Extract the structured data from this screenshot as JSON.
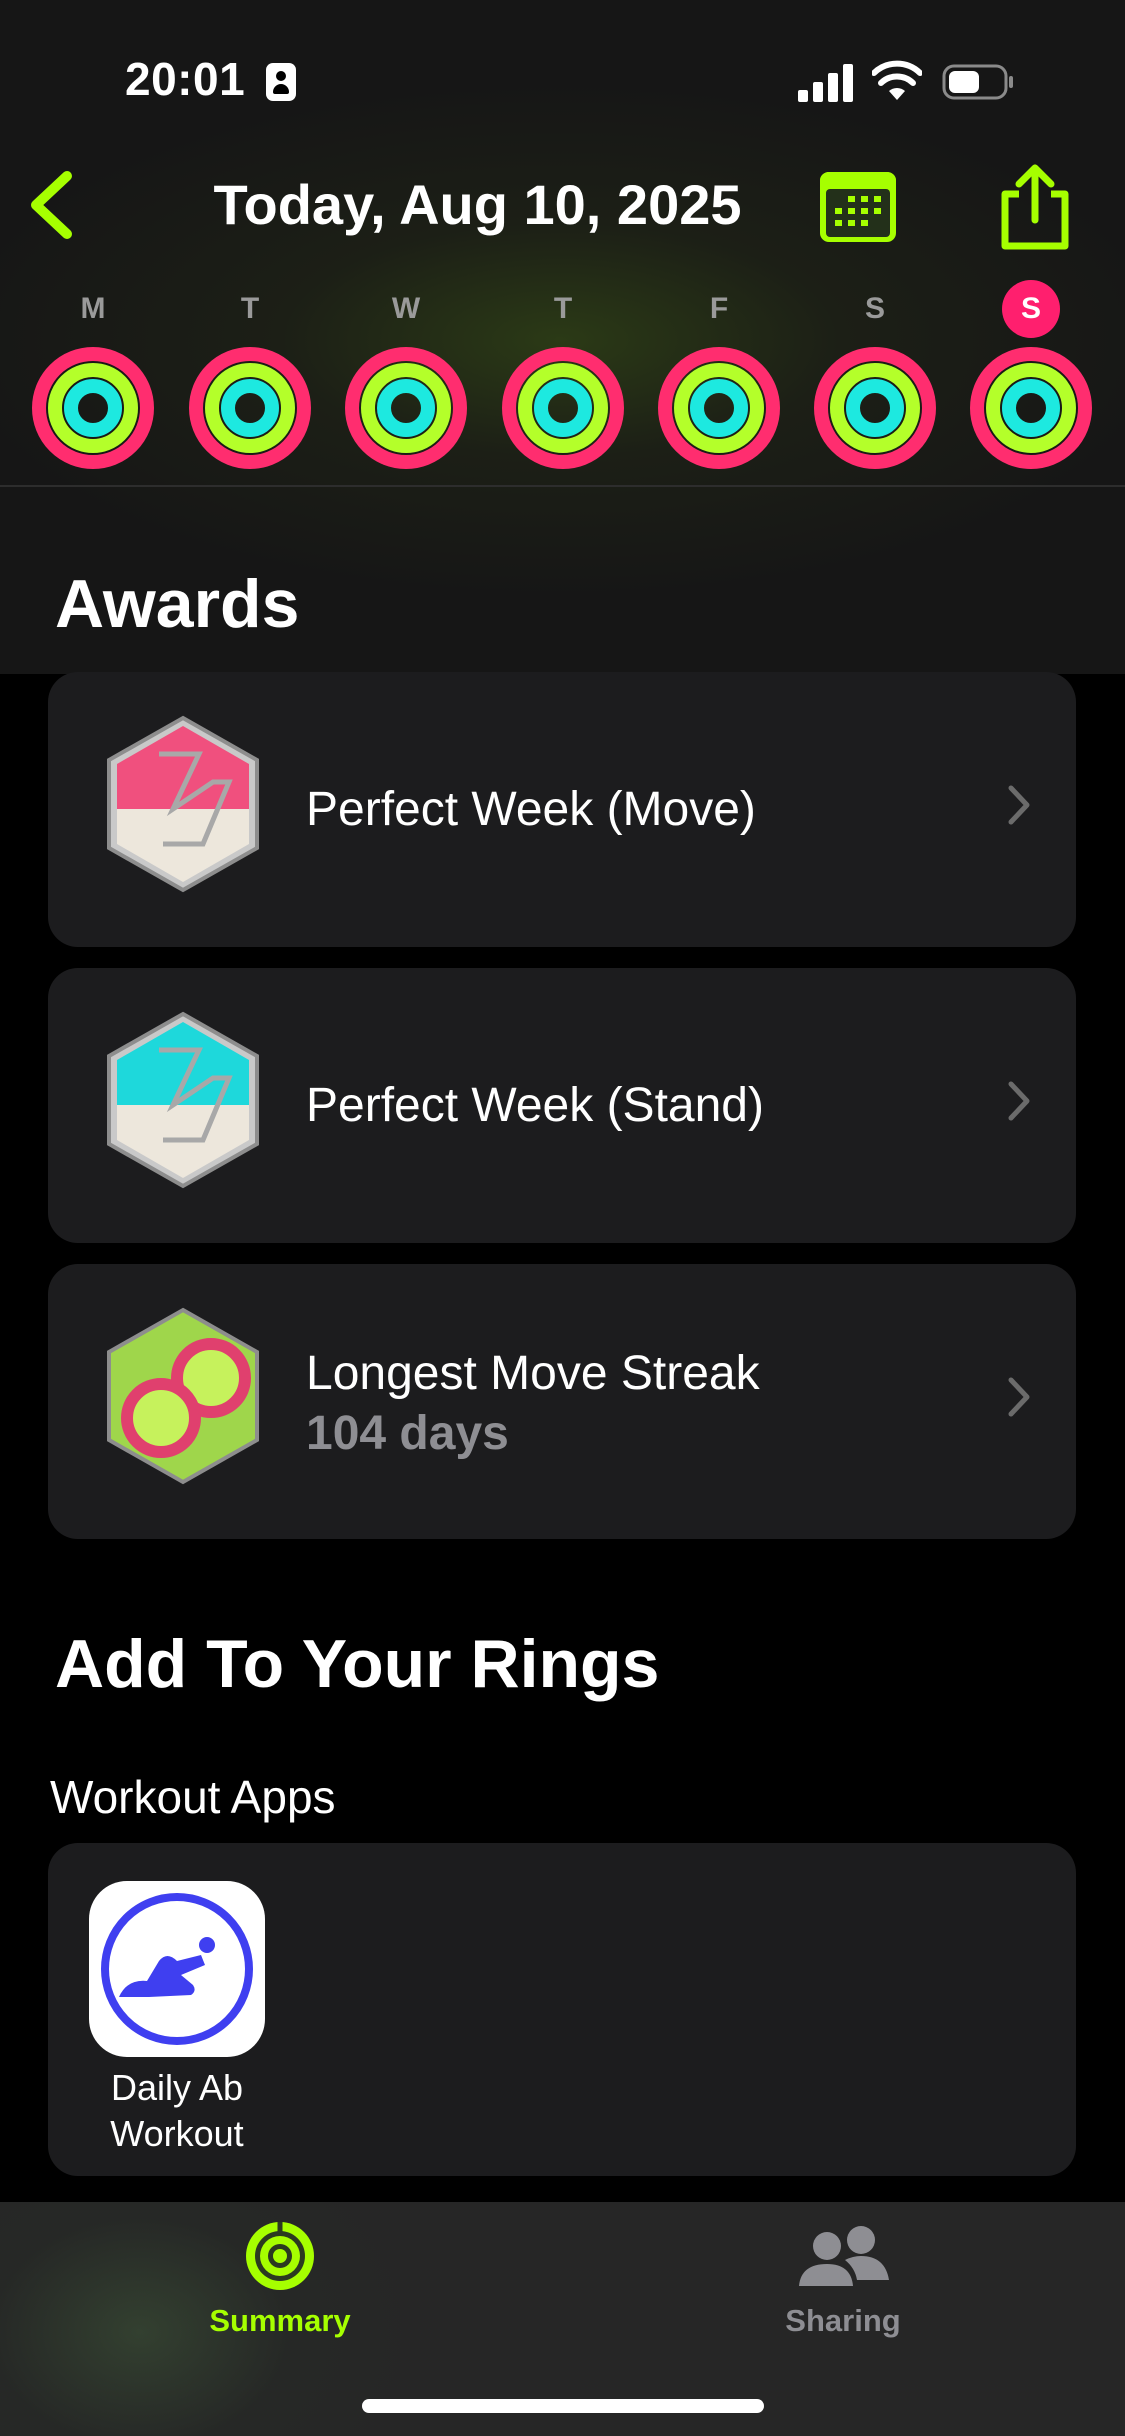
{
  "status_bar": {
    "time": "20:01"
  },
  "header": {
    "title": "Today, Aug 10, 2025"
  },
  "week": {
    "days": [
      {
        "label": "M",
        "active": false
      },
      {
        "label": "T",
        "active": false
      },
      {
        "label": "W",
        "active": false
      },
      {
        "label": "T",
        "active": false
      },
      {
        "label": "F",
        "active": false
      },
      {
        "label": "S",
        "active": false
      },
      {
        "label": "S",
        "active": true
      }
    ]
  },
  "awards": {
    "title": "Awards",
    "items": [
      {
        "title": "Perfect Week (Move)",
        "subtitle": "",
        "badge": "perfect-week-move-badge-icon"
      },
      {
        "title": "Perfect Week (Stand)",
        "subtitle": "",
        "badge": "perfect-week-stand-badge-icon"
      },
      {
        "title": "Longest Move Streak",
        "subtitle": "104 days",
        "badge": "move-streak-badge-icon"
      }
    ]
  },
  "add_rings": {
    "title": "Add To Your Rings",
    "subtitle": "Workout Apps",
    "apps": [
      {
        "line1": "Daily Ab",
        "line2": "Workout",
        "icon": "situp-figure-icon"
      }
    ]
  },
  "tab_bar": {
    "tabs": [
      {
        "label": "Summary",
        "icon": "activity-rings-icon",
        "selected": true
      },
      {
        "label": "Sharing",
        "icon": "people-icon",
        "selected": false
      }
    ]
  },
  "colors": {
    "accent": "#a6ff00",
    "move": "#ff2d6f",
    "exercise": "#b4ff2a",
    "stand": "#1de9e0",
    "card": "#1c1c1e"
  }
}
